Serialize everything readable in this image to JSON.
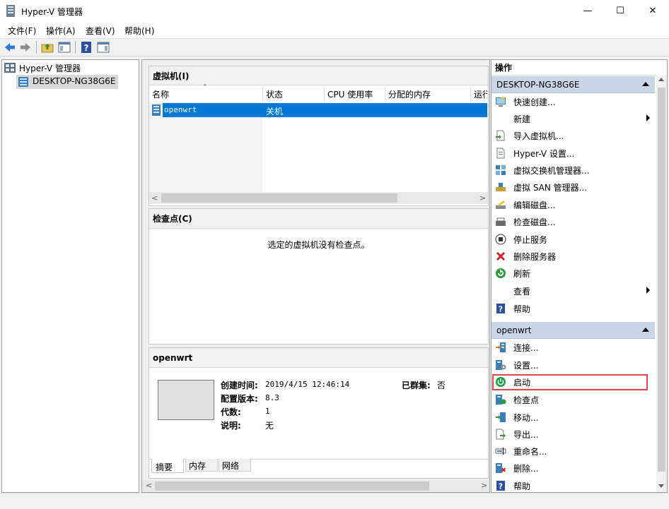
{
  "window": {
    "title": "Hyper-V 管理器",
    "minimize": "—",
    "maximize": "☐",
    "close": "✕"
  },
  "menu": [
    "文件(F)",
    "操作(A)",
    "查看(V)",
    "帮助(H)"
  ],
  "tree": {
    "root": "Hyper-V 管理器",
    "host": "DESKTOP-NG38G6E"
  },
  "vms": {
    "header": "虚拟机(I)",
    "columns": [
      "名称",
      "状态",
      "CPU 使用率",
      "分配的内存",
      "运行"
    ],
    "rows": [
      {
        "name": "openwrt",
        "state": "关机",
        "cpu": "",
        "memory": ""
      }
    ]
  },
  "checkpoints": {
    "header": "检查点(C)",
    "empty": "选定的虚拟机没有检查点。"
  },
  "details": {
    "header": "openwrt",
    "created_label": "创建时间:",
    "created_value": "2019/4/15 12:46:14",
    "clustered_label": "已群集:",
    "clustered_value": "否",
    "config_label": "配置版本:",
    "config_value": "8.3",
    "gen_label": "代数:",
    "gen_value": "1",
    "notes_label": "说明:",
    "notes_value": "无",
    "tabs": [
      "摘要",
      "内存",
      "网络"
    ]
  },
  "actions": {
    "header": "操作",
    "host_group": "DESKTOP-NG38G6E",
    "host_items": [
      "快速创建...",
      "新建",
      "导入虚拟机...",
      "Hyper-V 设置...",
      "虚拟交换机管理器...",
      "虚拟 SAN 管理器...",
      "编辑磁盘...",
      "检查磁盘...",
      "停止服务",
      "删除服务器",
      "刷新",
      "查看",
      "帮助"
    ],
    "vm_group": "openwrt",
    "vm_items": [
      "连接...",
      "设置...",
      "启动",
      "检查点",
      "移动...",
      "导出...",
      "重命名...",
      "删除...",
      "帮助"
    ]
  },
  "colors": {
    "selection": "#0078d7",
    "group_header": "#c8d6e8",
    "highlight_box": "#e0474c"
  }
}
